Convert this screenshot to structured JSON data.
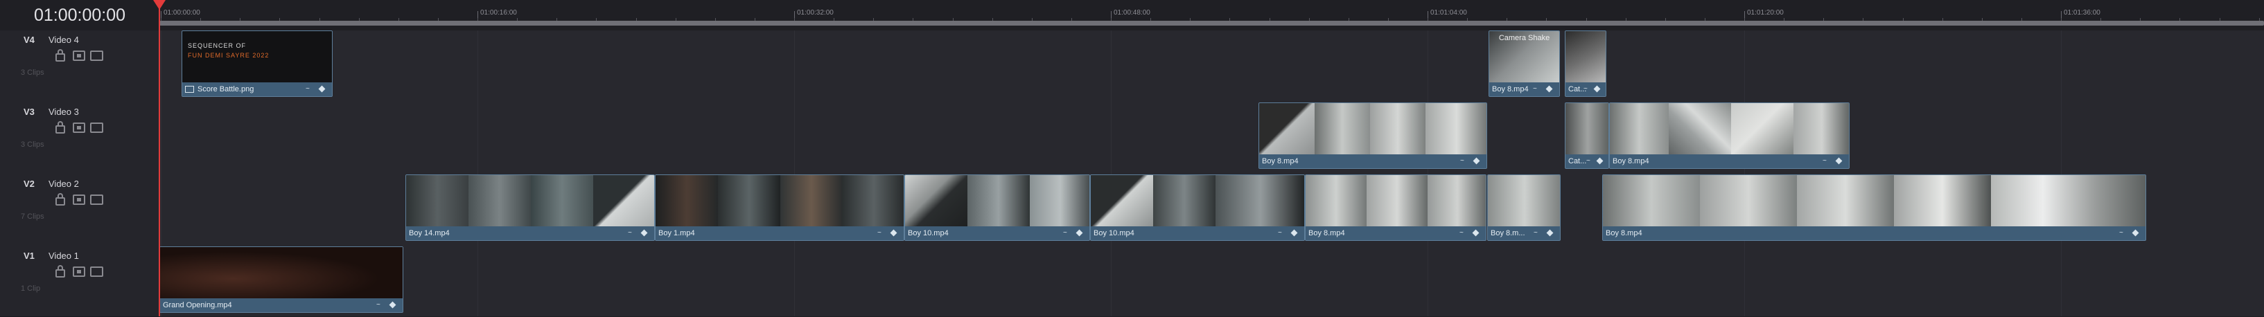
{
  "header": {
    "timecode": "01:00:00:00",
    "ruler_labels": [
      "01:00:00:00",
      "01:00:16:00",
      "01:00:32:00",
      "01:00:48:00",
      "01:01:04:00",
      "01:01:20:00",
      "01:01:36:00"
    ]
  },
  "tracks": [
    {
      "id": "V4",
      "name": "Video 4",
      "clip_count": "3 Clips",
      "clips": [
        {
          "name": "Score Battle.png",
          "type": "image",
          "title_line1": "SEQUENCER OF",
          "title_line2": "FUN DEMI SAYRE 2022"
        },
        {
          "name": "Boy 8.mp4",
          "type": "video",
          "caption": "Camera Shake"
        },
        {
          "name": "Cat...",
          "type": "video"
        }
      ]
    },
    {
      "id": "V3",
      "name": "Video 3",
      "clip_count": "3 Clips",
      "clips": [
        {
          "name": "Boy 8.mp4",
          "type": "video"
        },
        {
          "name": "Cat...",
          "type": "video"
        },
        {
          "name": "Boy 8.mp4",
          "type": "video"
        }
      ]
    },
    {
      "id": "V2",
      "name": "Video 2",
      "clip_count": "7 Clips",
      "clips": [
        {
          "name": "Boy 14.mp4",
          "type": "video"
        },
        {
          "name": "Boy 1.mp4",
          "type": "video"
        },
        {
          "name": "Boy 10.mp4",
          "type": "video"
        },
        {
          "name": "Boy 10.mp4",
          "type": "video"
        },
        {
          "name": "Boy 8.mp4",
          "type": "video"
        },
        {
          "name": "Boy 8.m...",
          "type": "video"
        },
        {
          "name": "Boy 8.mp4",
          "type": "video"
        }
      ]
    },
    {
      "id": "V1",
      "name": "Video 1",
      "clip_count": "1 Clip",
      "clips": [
        {
          "name": "Grand Opening.mp4",
          "type": "video"
        }
      ]
    }
  ],
  "colors": {
    "clip": "#3f5d77",
    "playhead": "#e33b3b",
    "background": "#28282e"
  }
}
